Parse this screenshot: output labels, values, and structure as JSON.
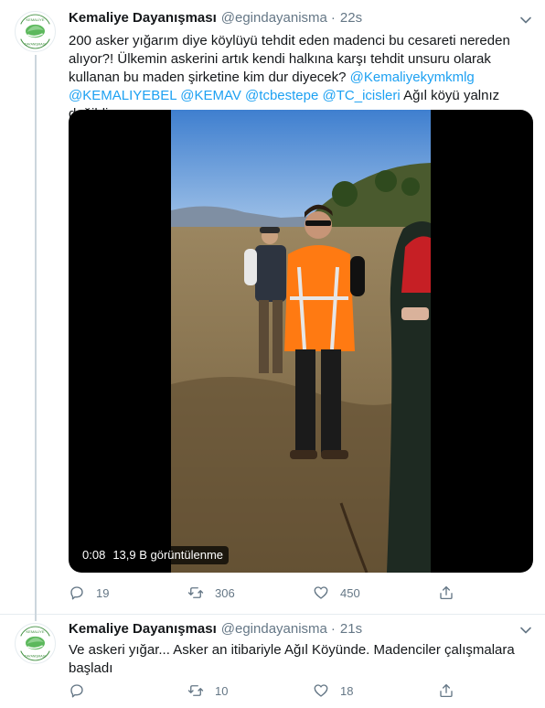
{
  "tweets": [
    {
      "author_name": "Kemaliye Dayanışması",
      "handle": "@egindayanisma",
      "separator": "·",
      "time": "22s",
      "text_parts": [
        "200 asker yığarım diye köylüyü tehdit eden madenci bu cesareti nereden alıyor?! Ülkemin askerini artık kendi halkına karşı tehdit unsuru olarak kullanan bu maden şirketine kim dur diyecek? ",
        "@Kemaliyekymkmlg",
        " ",
        "@KEMALIYEBEL",
        " ",
        "@KEMAV",
        " ",
        "@tcbestepe",
        " ",
        "@TC_icisleri",
        " Ağıl köyü yalnız değildir."
      ],
      "video": {
        "duration": "0:08",
        "views": "13,9 B görüntülenme"
      },
      "actions": {
        "replies": "19",
        "retweets": "306",
        "likes": "450"
      }
    },
    {
      "author_name": "Kemaliye Dayanışması",
      "handle": "@egindayanisma",
      "separator": "·",
      "time": "21s",
      "text_parts": [
        "Ve askeri yığar... Asker an itibariyle Ağıl Köyünde. Madenciler çalışmalara başladı"
      ],
      "actions": {
        "replies": "",
        "retweets": "10",
        "likes": "18"
      }
    }
  ],
  "avatar_text": {
    "top": "KEMALİYE",
    "bottom": "DAYANIŞMASI"
  },
  "icons": {
    "reply": "reply-icon",
    "retweet": "retweet-icon",
    "like": "heart-icon",
    "share": "share-icon",
    "caret": "chevron-down-icon"
  },
  "colors": {
    "accent": "#1da1f2",
    "text": "#14171a",
    "muted": "#657786",
    "border": "#e6ecf0"
  }
}
